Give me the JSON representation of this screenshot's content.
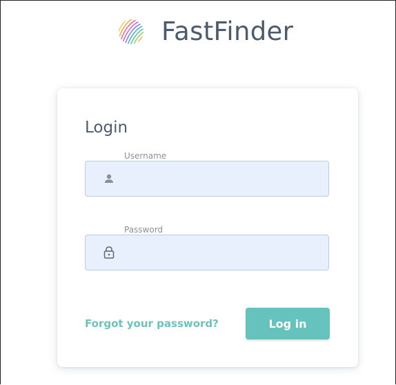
{
  "brand": {
    "name": "FastFinder",
    "logo_icon": "striped-sphere-logo"
  },
  "login": {
    "title": "Login",
    "username": {
      "label": "Username",
      "value": "",
      "icon": "user-icon"
    },
    "password": {
      "label": "Password",
      "value": "",
      "icon": "lock-icon"
    },
    "forgot_label": "Forgot your password?",
    "submit_label": "Log in"
  },
  "colors": {
    "accent": "#66c2bc",
    "text_dark": "#4b5a6d",
    "input_bg": "#e8f0fe",
    "input_border": "#bccce6"
  }
}
